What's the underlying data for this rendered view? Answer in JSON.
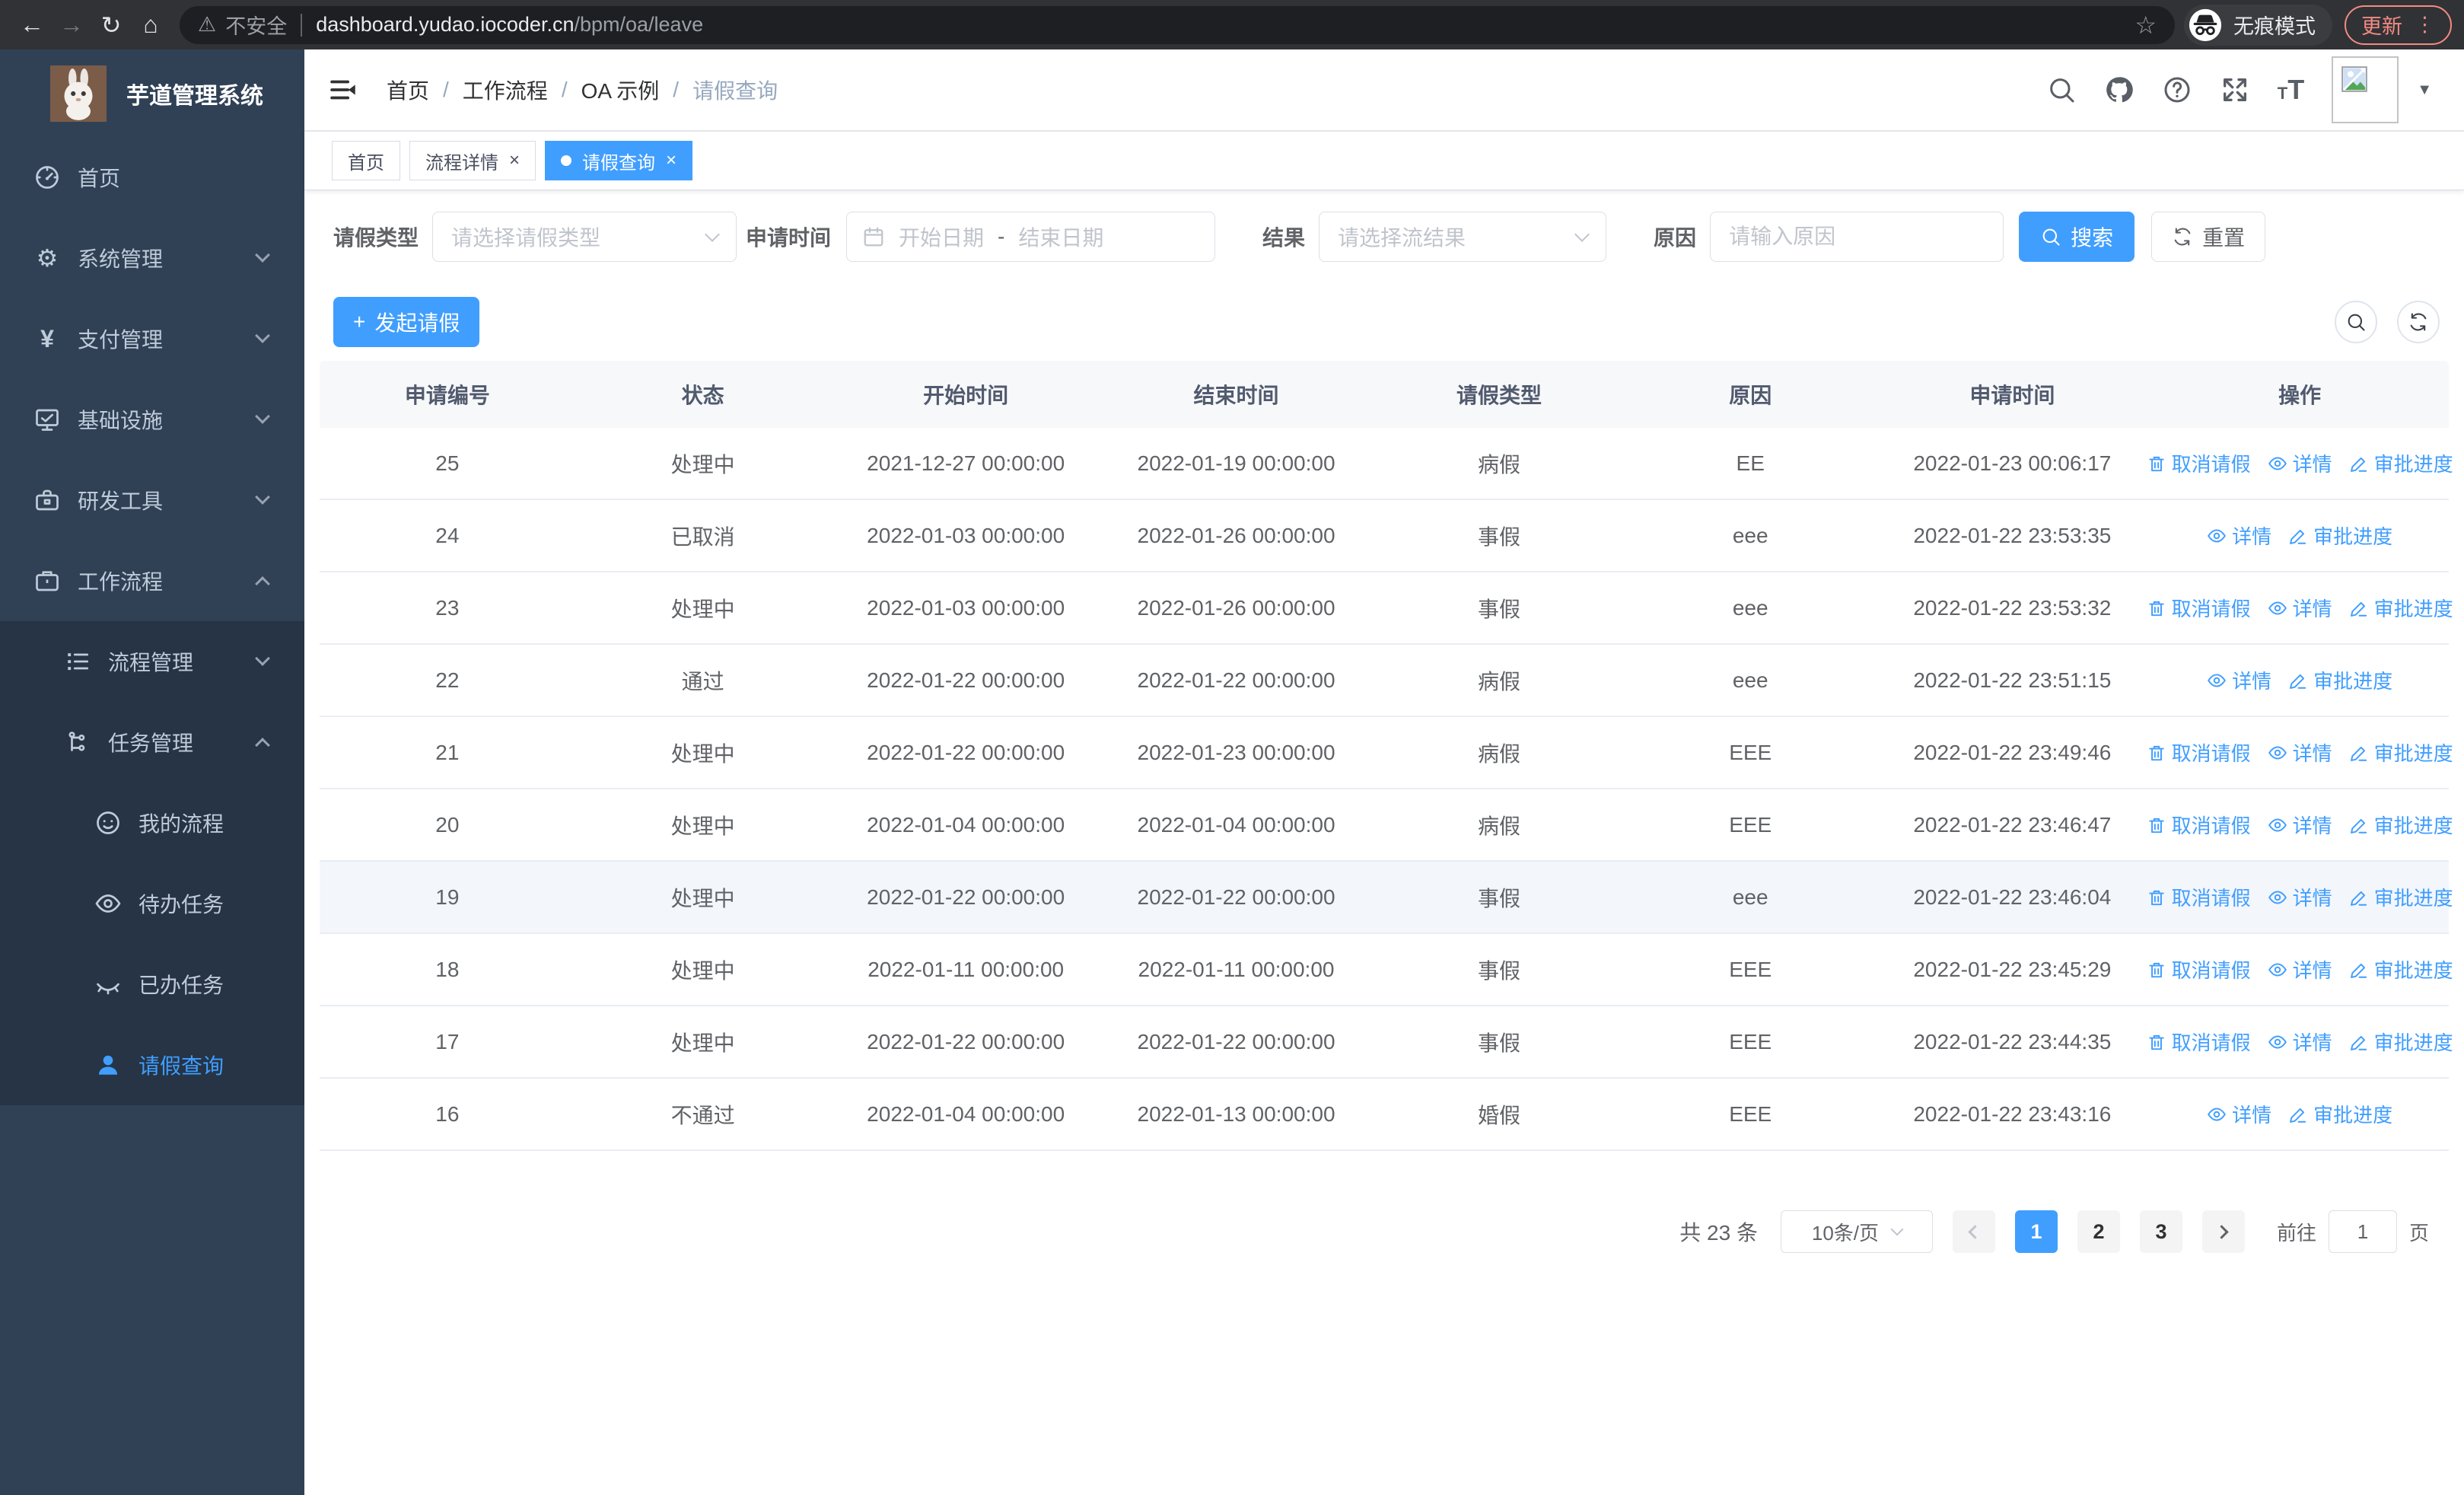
{
  "browser": {
    "security_label": "不安全",
    "url_host": "dashboard.yudao.iocoder.cn",
    "url_path": "/bpm/oa/leave",
    "incognito_label": "无痕模式",
    "update_label": "更新"
  },
  "icons": {
    "back": "←",
    "forward": "→",
    "reload": "↻",
    "home": "⌂",
    "warning": "⚠",
    "star": "☆",
    "dots": "⋮",
    "caret": "▼",
    "slash": "/",
    "close": "×",
    "plus": "+",
    "gear": "⚙",
    "yen": "¥",
    "font_small": "T",
    "font_large": "T"
  },
  "sidebar": {
    "title": "芋道管理系统",
    "items": [
      {
        "label": "首页"
      },
      {
        "label": "系统管理"
      },
      {
        "label": "支付管理"
      },
      {
        "label": "基础设施"
      },
      {
        "label": "研发工具"
      },
      {
        "label": "工作流程"
      },
      {
        "label": "流程管理"
      },
      {
        "label": "任务管理"
      },
      {
        "label": "我的流程"
      },
      {
        "label": "待办任务"
      },
      {
        "label": "已办任务"
      },
      {
        "label": "请假查询"
      }
    ]
  },
  "breadcrumb": {
    "items": [
      "首页",
      "工作流程",
      "OA 示例",
      "请假查询"
    ]
  },
  "tabs": [
    {
      "label": "首页"
    },
    {
      "label": "流程详情"
    },
    {
      "label": "请假查询"
    }
  ],
  "filters": {
    "leave_type_label": "请假类型",
    "leave_type_placeholder": "请选择请假类型",
    "apply_time_label": "申请时间",
    "start_date_placeholder": "开始日期",
    "date_separator": "-",
    "end_date_placeholder": "结束日期",
    "result_label": "结果",
    "result_placeholder": "请选择流结果",
    "reason_label": "原因",
    "reason_placeholder": "请输入原因",
    "search_label": "搜索",
    "reset_label": "重置"
  },
  "toolbar": {
    "create_label": "发起请假"
  },
  "table": {
    "columns": [
      "申请编号",
      "状态",
      "开始时间",
      "结束时间",
      "请假类型",
      "原因",
      "申请时间",
      "操作"
    ],
    "action_labels": {
      "cancel": "取消请假",
      "detail": "详情",
      "progress": "审批进度"
    },
    "rows": [
      {
        "id": "25",
        "status": "处理中",
        "start_time": "2021-12-27 00:00:00",
        "end_time": "2022-01-19 00:00:00",
        "leave_type": "病假",
        "reason": "EE",
        "apply_time": "2022-01-23 00:06:17"
      },
      {
        "id": "24",
        "status": "已取消",
        "start_time": "2022-01-03 00:00:00",
        "end_time": "2022-01-26 00:00:00",
        "leave_type": "事假",
        "reason": "eee",
        "apply_time": "2022-01-22 23:53:35"
      },
      {
        "id": "23",
        "status": "处理中",
        "start_time": "2022-01-03 00:00:00",
        "end_time": "2022-01-26 00:00:00",
        "leave_type": "事假",
        "reason": "eee",
        "apply_time": "2022-01-22 23:53:32"
      },
      {
        "id": "22",
        "status": "通过",
        "start_time": "2022-01-22 00:00:00",
        "end_time": "2022-01-22 00:00:00",
        "leave_type": "病假",
        "reason": "eee",
        "apply_time": "2022-01-22 23:51:15"
      },
      {
        "id": "21",
        "status": "处理中",
        "start_time": "2022-01-22 00:00:00",
        "end_time": "2022-01-23 00:00:00",
        "leave_type": "病假",
        "reason": "EEE",
        "apply_time": "2022-01-22 23:49:46"
      },
      {
        "id": "20",
        "status": "处理中",
        "start_time": "2022-01-04 00:00:00",
        "end_time": "2022-01-04 00:00:00",
        "leave_type": "病假",
        "reason": "EEE",
        "apply_time": "2022-01-22 23:46:47"
      },
      {
        "id": "19",
        "status": "处理中",
        "start_time": "2022-01-22 00:00:00",
        "end_time": "2022-01-22 00:00:00",
        "leave_type": "事假",
        "reason": "eee",
        "apply_time": "2022-01-22 23:46:04"
      },
      {
        "id": "18",
        "status": "处理中",
        "start_time": "2022-01-11 00:00:00",
        "end_time": "2022-01-11 00:00:00",
        "leave_type": "事假",
        "reason": "EEE",
        "apply_time": "2022-01-22 23:45:29"
      },
      {
        "id": "17",
        "status": "处理中",
        "start_time": "2022-01-22 00:00:00",
        "end_time": "2022-01-22 00:00:00",
        "leave_type": "事假",
        "reason": "EEE",
        "apply_time": "2022-01-22 23:44:35"
      },
      {
        "id": "16",
        "status": "不通过",
        "start_time": "2022-01-04 00:00:00",
        "end_time": "2022-01-13 00:00:00",
        "leave_type": "婚假",
        "reason": "EEE",
        "apply_time": "2022-01-22 23:43:16"
      }
    ]
  },
  "pagination": {
    "total": "共 23 条",
    "page_size": "10条/页",
    "pages": [
      "1",
      "2",
      "3"
    ],
    "goto_label": "前往",
    "goto_value": "1",
    "unit_label": "页"
  }
}
